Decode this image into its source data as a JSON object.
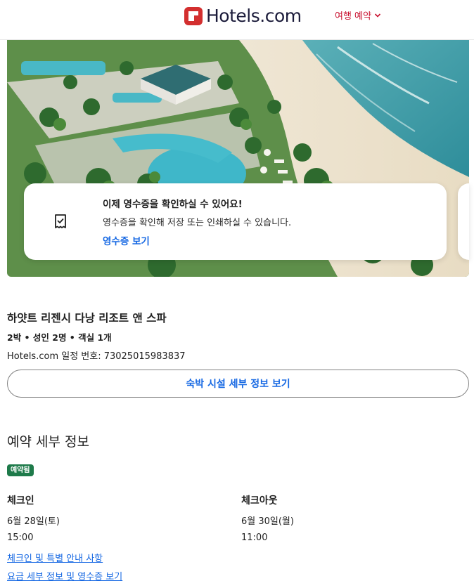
{
  "header": {
    "brand": "Hotels.com",
    "trips_menu": "여행 예약"
  },
  "receipt_card": {
    "title": "이제 영수증을 확인하실 수 있어요!",
    "description": "영수증을 확인해 저장 또는 인쇄하실 수 있습니다.",
    "link": "영수증 보기"
  },
  "property": {
    "name": "하얏트 리젠시 다낭 리조트 앤 스파",
    "stay_summary": "2박 • 성인 2명 • 객실 1개",
    "itinerary": "Hotels.com 일정 번호: 73025015983837",
    "details_button": "숙박 시설 세부 정보 보기"
  },
  "booking": {
    "title": "예약 세부 정보",
    "status": "예약됨",
    "checkin": {
      "label": "체크인",
      "date": "6월 28일(토)",
      "time": "15:00"
    },
    "checkout": {
      "label": "체크아웃",
      "date": "6월 30일(월)",
      "time": "11:00"
    },
    "links": {
      "instructions": "체크인 및 특별 안내 사항",
      "price_details": "요금 세부 정보 및 영수증 보기"
    }
  },
  "colors": {
    "accent_link": "#1668e3",
    "brand_red": "#d32f2f",
    "badge_green": "#1e7a4a"
  }
}
